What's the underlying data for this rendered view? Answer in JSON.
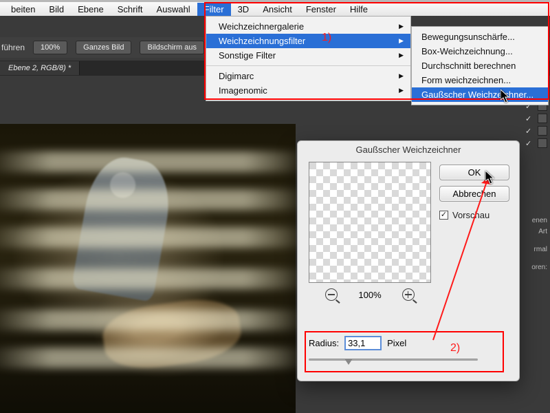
{
  "menubar": {
    "items": [
      "beiten",
      "Bild",
      "Ebene",
      "Schrift",
      "Auswahl",
      "Filter",
      "3D",
      "Ansicht",
      "Fenster",
      "Hilfe"
    ],
    "active_index": 5
  },
  "optionbar": {
    "label_left": "führen",
    "zoom": "100%",
    "btn1": "Ganzes Bild",
    "btn2": "Bildschirm aus"
  },
  "tabbar": {
    "tab1": "Ebene 2, RGB/8) *"
  },
  "menu_filter": {
    "i0": "Weichzeichnergalerie",
    "i1": "Weichzeichnungsfilter",
    "i2": "Sonstige Filter",
    "i3": "Digimarc",
    "i4": "Imagenomic"
  },
  "menu_blur": {
    "i0": "Bewegungsunschärfe...",
    "i1": "Box-Weichzeichnung...",
    "i2": "Durchschnitt berechnen",
    "i3": "Form weichzeichnen...",
    "i4": "Gaußscher Weichzeichner..."
  },
  "annotations": {
    "a1": "1)",
    "a2": "2)"
  },
  "dialog": {
    "title": "Gaußscher Weichzeichner",
    "ok": "OK",
    "cancel": "Abbrechen",
    "preview_label": "Vorschau",
    "preview_checked": true,
    "zoom": "100%",
    "radius_label": "Radius:",
    "radius_value": "33,1",
    "radius_unit": "Pixel"
  },
  "rightpanel": {
    "tag1": "enen",
    "tag2": "Art",
    "tag3": "rmal",
    "tag4": "oren:"
  }
}
